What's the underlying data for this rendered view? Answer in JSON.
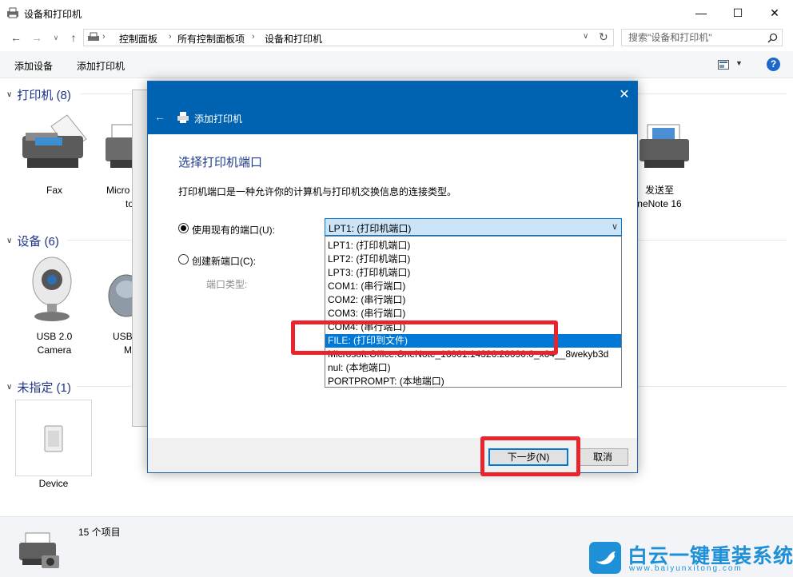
{
  "window": {
    "title": "设备和打印机"
  },
  "nav": {
    "breadcrumbs": [
      "控制面板",
      "所有控制面板项",
      "设备和打印机"
    ],
    "search_placeholder": "搜索\"设备和打印机\""
  },
  "commands": {
    "add_device": "添加设备",
    "add_printer": "添加打印机"
  },
  "groups": {
    "printers": {
      "label": "打印机 (8)"
    },
    "devices": {
      "label": "设备 (6)"
    },
    "unspecified": {
      "label": "未指定 (1)"
    }
  },
  "printers": [
    {
      "line1": "Fax",
      "line2": ""
    },
    {
      "line1": "Micro",
      "line2": "to"
    },
    {
      "line1": "发送至",
      "line2": "neNote 16"
    }
  ],
  "devices": [
    {
      "line1": "USB 2.0",
      "line2": "Camera"
    },
    {
      "line1": "USB",
      "line2": "M"
    }
  ],
  "unspecified": [
    {
      "line1": "Device"
    }
  ],
  "status": {
    "item_count": "15 个项目"
  },
  "dialog": {
    "title": "添加打印机",
    "section_title": "选择打印机端口",
    "description": "打印机端口是一种允许你的计算机与打印机交换信息的连接类型。",
    "use_existing_label": "使用现有的端口(U):",
    "create_new_label": "创建新端口(C):",
    "port_type_label": "端口类型:",
    "selected_port": "LPT1: (打印机端口)",
    "port_options": [
      "LPT1: (打印机端口)",
      "LPT2: (打印机端口)",
      "LPT3: (打印机端口)",
      "COM1: (串行端口)",
      "COM2: (串行端口)",
      "COM3: (串行端口)",
      "COM4: (串行端口)",
      "FILE: (打印到文件)",
      "Microsoft.Office.OneNote_16001.14326.20090.0_x64__8wekyb3d",
      "nul: (本地端口)",
      "PORTPROMPT: (本地端口)"
    ],
    "highlighted_option_index": 7,
    "next_button": "下一步(N)",
    "cancel_button": "取消"
  },
  "watermark": {
    "name": "白云一键重装系统",
    "url": "www.baiyunxitong.com"
  },
  "colors": {
    "dialog_header": "#0063b1",
    "selection": "#0078d7",
    "highlight_box": "#e8252c",
    "group_header": "#1e3287"
  }
}
